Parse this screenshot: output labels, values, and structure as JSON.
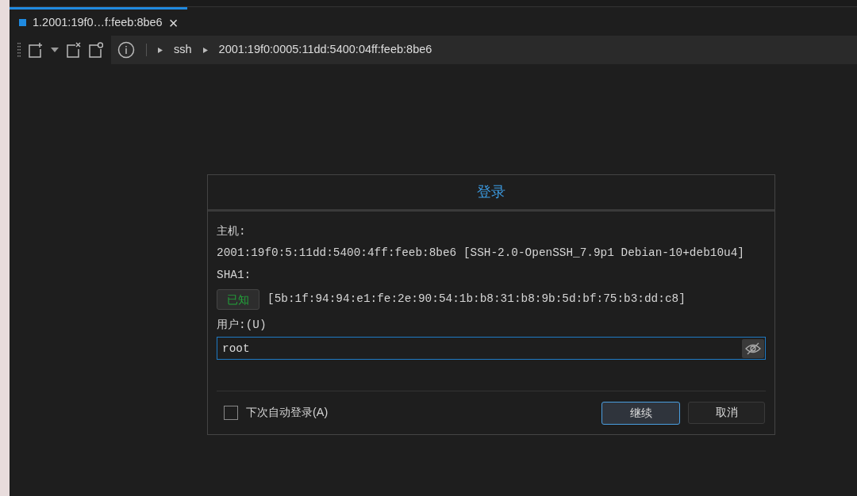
{
  "tabs": [
    {
      "label": "1.2001:19f0…f:feeb:8be6",
      "selected": true,
      "close": "×"
    }
  ],
  "breadcrumb": [
    "ssh",
    "2001:19f0:0005:11dd:5400:04ff:feeb:8be6"
  ],
  "dialog": {
    "title": "登录",
    "host_label": "主机:",
    "host_value": "2001:19f0:5:11dd:5400:4ff:feeb:8be6 [SSH-2.0-OpenSSH_7.9p1 Debian-10+deb10u4]",
    "sha_label": "SHA1:",
    "known_badge": "已知",
    "fingerprint": "[5b:1f:94:94:e1:fe:2e:90:54:1b:b8:31:b8:9b:5d:bf:75:b3:dd:c8]",
    "user_label": "用户:(U)",
    "user_value": "root",
    "auto_login": {
      "label": "下次自动登录(A)",
      "checked": false
    },
    "buttons": [
      {
        "label": "继续",
        "selected": true
      },
      {
        "label": "取消",
        "selected": false
      }
    ]
  }
}
